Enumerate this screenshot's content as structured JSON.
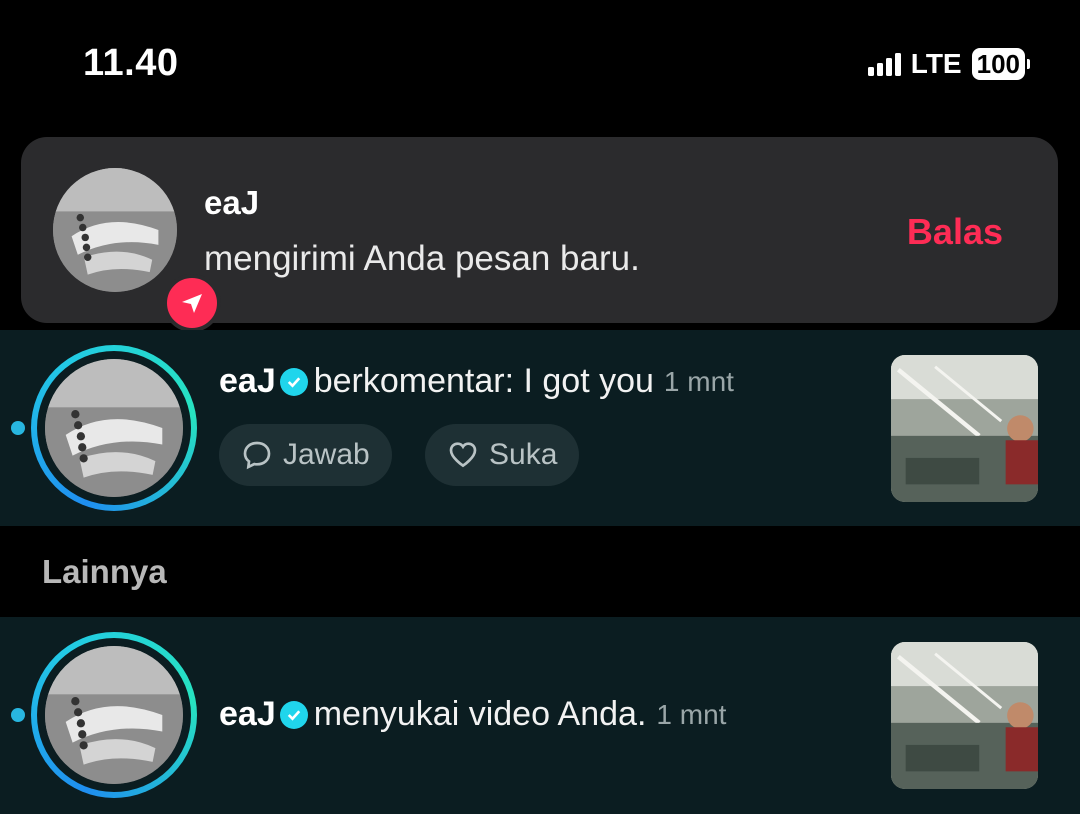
{
  "status_bar": {
    "time": "11.40",
    "network": "LTE",
    "battery": "100"
  },
  "banner": {
    "sender": "eaJ",
    "message": "mengirimi Anda pesan baru.",
    "reply_label": "Balas",
    "badge_icon": "paper-plane-icon"
  },
  "activity": [
    {
      "user": "eaJ",
      "message": "berkomentar: I got you",
      "time": "1 mnt",
      "reply_label": "Jawab",
      "like_label": "Suka",
      "unread": true
    },
    {
      "user": "eaJ",
      "message": "menyukai video Anda.",
      "time": "1 mnt",
      "unread": true
    }
  ],
  "section_label": "Lainnya",
  "colors": {
    "accent": "#fe2c55",
    "verified": "#20d5ec",
    "row_bg": "#0b1d21",
    "banner_bg": "#2b2b2d"
  }
}
